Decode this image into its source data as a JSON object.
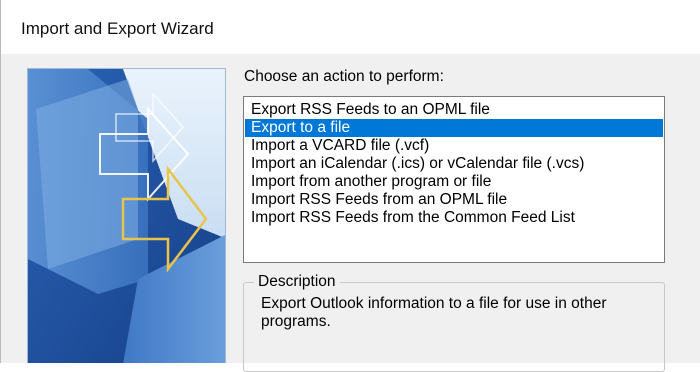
{
  "window": {
    "title": "Import and Export Wizard"
  },
  "action": {
    "label": "Choose an action to perform:",
    "items": [
      {
        "label": "Export RSS Feeds to an OPML file",
        "selected": false
      },
      {
        "label": "Export to a file",
        "selected": true
      },
      {
        "label": "Import a VCARD file (.vcf)",
        "selected": false
      },
      {
        "label": "Import an iCalendar (.ics) or vCalendar file (.vcs)",
        "selected": false
      },
      {
        "label": "Import from another program or file",
        "selected": false
      },
      {
        "label": "Import RSS Feeds from an OPML file",
        "selected": false
      },
      {
        "label": "Import RSS Feeds from the Common Feed List",
        "selected": false
      }
    ]
  },
  "description": {
    "legend": "Description",
    "text": "Export Outlook information to a file for use in other programs."
  },
  "banner": {
    "icon": "import-export-arrows"
  },
  "colors": {
    "selection": "#0078d7",
    "dialog_background": "#f0f0f0",
    "arrow_outline": "#e8c44a"
  }
}
